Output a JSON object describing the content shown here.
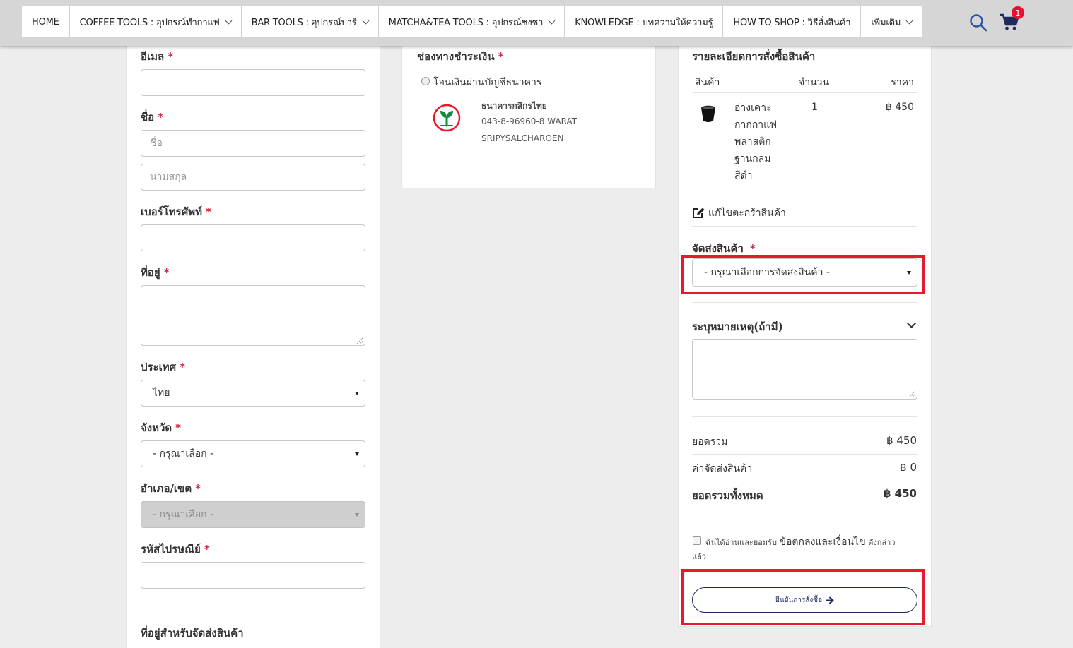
{
  "nav": {
    "items": [
      {
        "label": "HOME",
        "dropdown": false
      },
      {
        "label": "COFFEE TOOLS : อุปกรณ์ทำกาแฟ",
        "dropdown": true
      },
      {
        "label": "BAR TOOLS : อุปกรณ์บาร์",
        "dropdown": true
      },
      {
        "label": "MATCHA&TEA TOOLS : อุปกรณ์ชงชา",
        "dropdown": true
      },
      {
        "label": "KNOWLEDGE : บทความให้ความรู้",
        "dropdown": false
      },
      {
        "label": "HOW TO SHOP : วิธีสั่งสินค้า",
        "dropdown": false
      },
      {
        "label": "เพิ่มเติม",
        "dropdown": true
      }
    ],
    "cart_count": "1",
    "icon_color": "#2a55a5",
    "cart_color": "#1f2a5c",
    "badge_color": "#e8112d"
  },
  "form": {
    "email_label": "อีเมล",
    "name_label": "ชื่อ",
    "first_name_placeholder": "ชื่อ",
    "last_name_placeholder": "นามสกุล",
    "phone_label": "เบอร์โทรศัพท์",
    "address_label": "ที่อยู่",
    "country_label": "ประเทศ",
    "country_value": "ไทย",
    "province_label": "จังหวัด",
    "province_value": "- กรุณาเลือก -",
    "district_label": "อำเภอ/เขต",
    "district_value": "- กรุณาเลือก -",
    "postcode_label": "รหัสไปรษณีย์",
    "shipping_address_heading": "ที่อยู่สำหรับจัดส่งสินค้า",
    "required_mark": "*"
  },
  "payment": {
    "heading": "ช่องทางชำระเงิน",
    "method_label": "โอนเงินผ่านบัญชีธนาคาร",
    "bank_name": "ธนาคารกสิกรไทย",
    "account_line": "043-8-96960-8 WARAT",
    "account_name": "SRIPYSALCHAROEN",
    "bank_color": "#128a3c"
  },
  "order": {
    "heading": "รายละเอียดการสั่งซื้อสินค้า",
    "col_product": "สินค้า",
    "col_qty": "จำนวน",
    "col_price": "ราคา",
    "item": {
      "name_lines": [
        "อ่างเคาะ",
        "กากกาแฟ",
        "พลาสติก",
        "ฐานกลม",
        "สีดำ"
      ],
      "qty": "1",
      "price": "฿ 450"
    },
    "edit_cart": "แก้ไขตะกร้าสินค้า",
    "shipping_label": "จัดส่งสินค้า",
    "shipping_value": "- กรุณาเลือกการจัดส่งสินค้า -",
    "note_label": "ระบุหมายเหตุ(ถ้ามี)",
    "subtotal_label": "ยอดรวม",
    "subtotal_value": "฿ 450",
    "shipping_fee_label": "ค่าจัดส่งสินค้า",
    "shipping_fee_value": "฿ 0",
    "total_label": "ยอดรวมทั้งหมด",
    "total_value": "฿ 450",
    "terms_prefix": "ฉันได้อ่านและยอมรับ",
    "terms_link": "ข้อตกลงและเงื่อนไข",
    "terms_suffix": "ดังกล่าว",
    "terms_line2": "แล้ว",
    "confirm_label": "ยืนยันการสั่งซื้อ",
    "highlight_color": "#e8192c"
  }
}
